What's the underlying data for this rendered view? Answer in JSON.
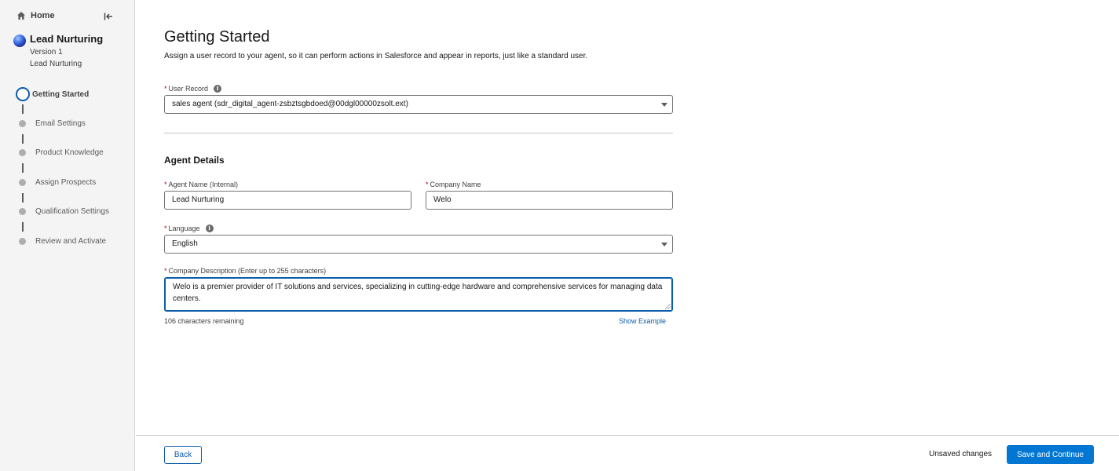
{
  "sidebar": {
    "home_label": "Home",
    "agent": {
      "name": "Lead Nurturing",
      "version": "Version 1",
      "type": "Lead Nurturing"
    },
    "steps": [
      {
        "label": "Getting Started",
        "state": "active"
      },
      {
        "label": "Email Settings",
        "state": "upcoming"
      },
      {
        "label": "Product Knowledge",
        "state": "upcoming"
      },
      {
        "label": "Assign Prospects",
        "state": "upcoming"
      },
      {
        "label": "Qualification Settings",
        "state": "upcoming"
      },
      {
        "label": "Review and Activate",
        "state": "upcoming"
      }
    ]
  },
  "page": {
    "title": "Getting Started",
    "description": "Assign a user record to your agent, so it can perform actions in Salesforce and appear in reports, just like a standard user."
  },
  "form": {
    "required_marker": "*",
    "user_record": {
      "label": "User Record",
      "value": "sales agent (sdr_digital_agent-zsbztsgbdoed@00dgl00000zsolt.ext)"
    },
    "section_title": "Agent Details",
    "agent_name": {
      "label": "Agent Name (Internal)",
      "value": "Lead Nurturing"
    },
    "company_name": {
      "label": "Company Name",
      "value": "Welo"
    },
    "language": {
      "label": "Language",
      "value": "English"
    },
    "company_description": {
      "label": "Company Description (Enter up to 255 characters)",
      "value": "Welo is a premier provider of IT solutions and services, specializing in cutting-edge hardware and comprehensive services for managing data centers.",
      "remaining": "106 characters remaining",
      "show_example_label": "Show Example"
    }
  },
  "footer": {
    "back_label": "Back",
    "unsaved_text": "Unsaved changes",
    "save_label": "Save and Continue"
  },
  "colors": {
    "brand_button": "#0176d3",
    "link": "#0b5cab",
    "required": "#ba0517",
    "sidebar_bg": "#f4f4f4"
  }
}
